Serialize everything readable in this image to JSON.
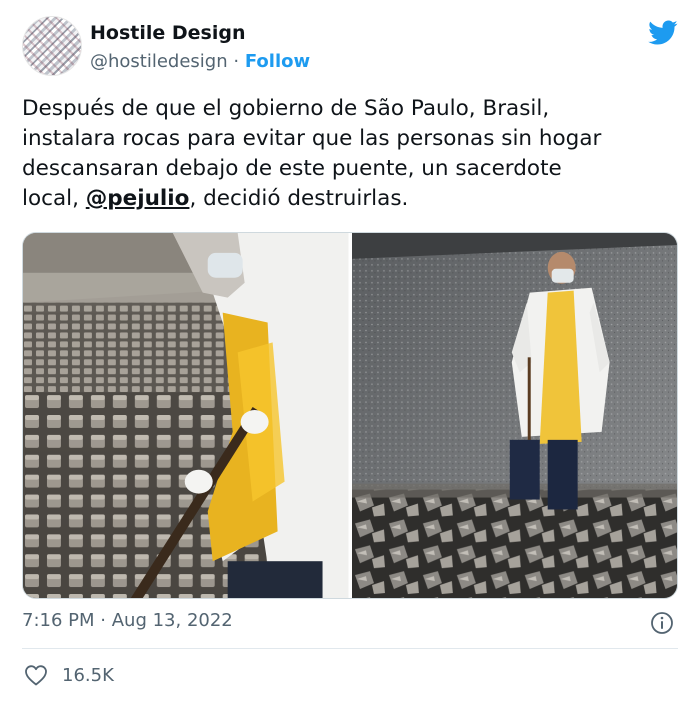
{
  "author": {
    "name": "Hostile Design",
    "handle": "@hostiledesign",
    "separator": "·",
    "follow_label": "Follow"
  },
  "icons": {
    "brand": "twitter-bird-icon",
    "info": "info-icon",
    "like": "heart-icon"
  },
  "colors": {
    "accent": "#1d9bf0",
    "text": "#0f1419",
    "muted": "#536471"
  },
  "tweet": {
    "line1": "Después de que el gobierno de São Paulo, Brasil,",
    "line2": "instalara rocas para evitar que las personas sin hogar",
    "line3": "descansaran debajo de este puente, un sacerdote",
    "line4_prefix": "local, ",
    "mention": "@pejulio",
    "line4_suffix": ", decidió destruirlas."
  },
  "timestamp": {
    "time": "7:16 PM",
    "separator": "·",
    "date": "Aug 13, 2022"
  },
  "engagement": {
    "likes": "16.5K"
  }
}
